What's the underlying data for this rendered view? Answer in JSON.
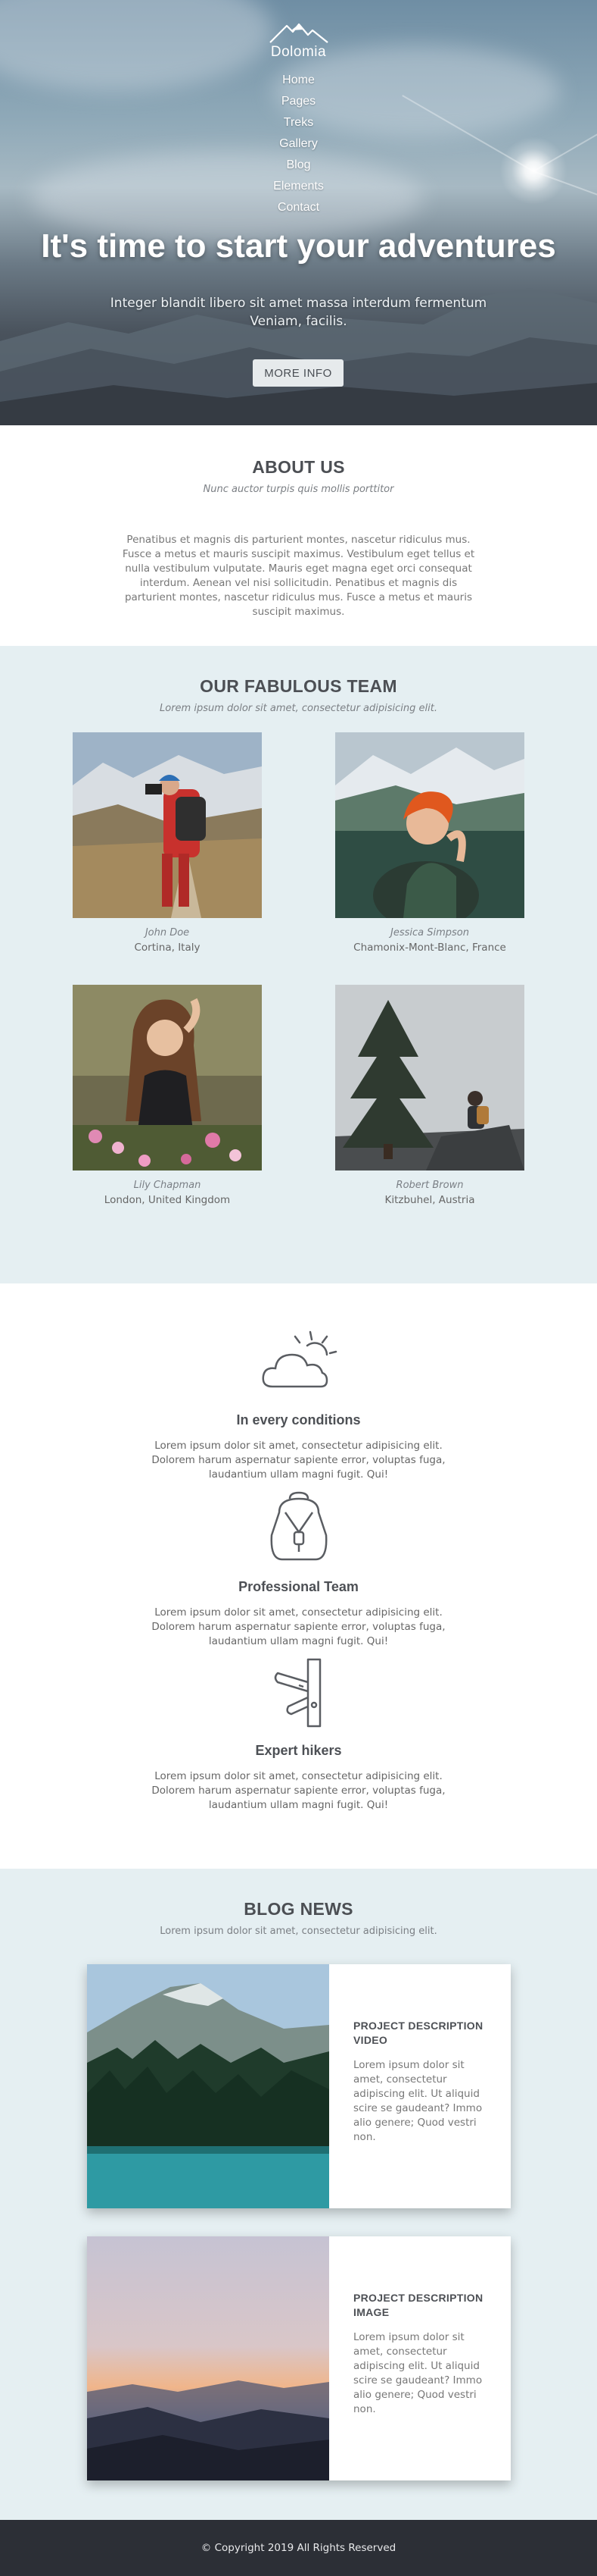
{
  "brand": {
    "name": "Dolomia"
  },
  "nav": [
    "Home",
    "Pages",
    "Treks",
    "Gallery",
    "Blog",
    "Elements",
    "Contact"
  ],
  "hero": {
    "title": "It's time to start your adventures",
    "subtitle": "Integer blandit libero sit amet massa interdum fermentum Veniam, facilis.",
    "button": "MORE INFO"
  },
  "about": {
    "title": "ABOUT US",
    "subtitle": "Nunc auctor turpis quis mollis porttitor",
    "text": "Penatibus et magnis dis parturient montes, nascetur ridiculus mus. Fusce a metus et mauris suscipit maximus. Vestibulum eget tellus et nulla vestibulum vulputate. Mauris eget magna eget orci consequat interdum. Aenean vel nisi sollicitudin. Penatibus et magnis dis parturient montes, nascetur ridiculus mus. Fusce a metus et mauris suscipit maximus."
  },
  "team": {
    "title": "OUR FABULOUS TEAM",
    "subtitle": "Lorem ipsum dolor sit amet, consectetur adipisicing elit.",
    "members": [
      {
        "name": "John Doe",
        "place": "Cortina, Italy"
      },
      {
        "name": "Jessica Simpson",
        "place": "Chamonix-Mont-Blanc, France"
      },
      {
        "name": "Lily Chapman",
        "place": "London, United Kingdom"
      },
      {
        "name": "Robert Brown",
        "place": "Kitzbuhel, Austria"
      }
    ]
  },
  "features": [
    {
      "icon": "cloud-sun-icon",
      "title": "In every conditions",
      "text": "Lorem ipsum dolor sit amet, consectetur adipisicing elit. Dolorem harum aspernatur sapiente error, voluptas fuga, laudantium ullam magni fugit. Qui!"
    },
    {
      "icon": "backpack-icon",
      "title": "Professional Team",
      "text": "Lorem ipsum dolor sit amet, consectetur adipisicing elit. Dolorem harum aspernatur sapiente error, voluptas fuga, laudantium ullam magni fugit. Qui!"
    },
    {
      "icon": "swiss-knife-icon",
      "title": "Expert hikers",
      "text": "Lorem ipsum dolor sit amet, consectetur adipisicing elit. Dolorem harum aspernatur sapiente error, voluptas fuga, laudantium ullam magni fugit. Qui!"
    }
  ],
  "blog": {
    "title": "BLOG NEWS",
    "subtitle": "Lorem ipsum dolor sit amet, consectetur adipisicing elit.",
    "posts": [
      {
        "title": "PROJECT DESCRIPTION VIDEO",
        "text": "Lorem ipsum dolor sit amet, consectetur adipiscing elit. Ut aliquid scire se gaudeant? Immo alio genere; Quod vestri non."
      },
      {
        "title": "PROJECT DESCRIPTION IMAGE",
        "text": "Lorem ipsum dolor sit amet, consectetur adipiscing elit. Ut aliquid scire se gaudeant? Immo alio genere; Quod vestri non."
      }
    ]
  },
  "footer": {
    "copyright": "© Copyright 2019 All Rights Reserved"
  },
  "colors": {
    "light_section": "#e5eff2",
    "footer": "#2c2f36",
    "heading": "#4c4f54"
  }
}
